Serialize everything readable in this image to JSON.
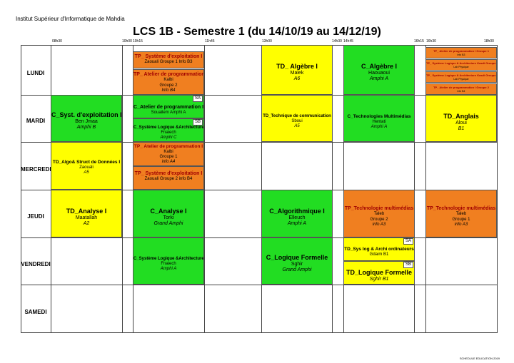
{
  "institute": "Institut Supérieur d'Informatique de Mahdia",
  "title": "LCS 1B - Semestre 1 (du 14/10/19 au 14/12/19)",
  "time_labels": [
    "08h30",
    "10h00",
    "10h15",
    "11h45",
    "13h00",
    "14h30",
    "14h45",
    "16h15",
    "16h30",
    "18h00"
  ],
  "days": [
    "LUNDI",
    "MARDI",
    "MERCREDI",
    "JEUDI",
    "VENDREDI",
    "SAMEDI"
  ],
  "sessions": {
    "lun_tp_sys": {
      "t": "TP_ Système d'exploitation I",
      "s": "Zaouali Groupe 1 Info B3"
    },
    "lun_tp_atelier": {
      "t": "TP_ Atelier de programmation I",
      "s": "Kalbi",
      "s2": "Groupe 2",
      "i": "Info B4"
    },
    "lun_td_alg": {
      "t": "TD_ Algèbre I",
      "s": "Malek",
      "i": "A6"
    },
    "lun_c_alg": {
      "t": "C_Algèbre I",
      "s": "Haouaoui",
      "i": "Amphi A"
    },
    "lun_s1": {
      "t": "TP_ Atelier de programmation I Groupe 1",
      "s": "info B3"
    },
    "lun_s2": {
      "t": "TP_ Système Logique & Architecture Kasdi Groupe 2",
      "s": "Lab Physique"
    },
    "lun_s3": {
      "t": "TP_ Système Logique & Architecture Kasdi Groupe 1",
      "s": "Lab Physique"
    },
    "lun_s4": {
      "t": "TP_ Atelier de programmation I Groupe 2",
      "s": "info B4"
    },
    "mar_c_sys": {
      "t": "C_Syst. d'exploitation I",
      "s": "Ben Jmaa",
      "i": "Amphi B"
    },
    "mar_c_atelier": {
      "t": "C_Atelier de programmation I",
      "s": "Souailem Amphi A",
      "tag": "SA"
    },
    "mar_c_syslog": {
      "t": "C_Système Logique &Architecture",
      "s": "Fnaiech",
      "i": "Amphi C",
      "tag": "SB"
    },
    "mar_td_tech": {
      "t": "TD_Technique de communication",
      "s": "Sboui",
      "i": "A5"
    },
    "mar_c_techmm": {
      "t": "C_Technologies Multimédias",
      "s": "Hentati",
      "i": "Amphi A"
    },
    "mar_td_ang": {
      "t": "TD_Anglais",
      "s": "Aloui",
      "i": "B1"
    },
    "mer_td_algo": {
      "t": "TD_Algo& Struct de Données I",
      "s": "Zaouali",
      "i": "A5"
    },
    "mer_tp_atelier": {
      "t": "TP_ Atelier de programmation I",
      "s": "Kalbi",
      "s2": "Groupe 1",
      "i": "info A4"
    },
    "mer_tp_sys": {
      "t": "TP_ Système d'exploitation I",
      "s": "Zaouali Groupe 2 info B4"
    },
    "jeu_td_ana": {
      "t": "TD_Analyse I",
      "s": "Maatallah",
      "i": "A2"
    },
    "jeu_c_ana": {
      "t": "C_Analyse I",
      "s": "Torki",
      "i": "Grand Amphi"
    },
    "jeu_c_algo": {
      "t": "C_Algorithmique I",
      "s": "Elleuch",
      "i": "Amphi A"
    },
    "jeu_tp_tech2": {
      "t": "TP_Technologie multimédias",
      "s": "Taleb",
      "s2": "Groupe 2",
      "i": "info A3"
    },
    "jeu_tp_tech1": {
      "t": "TP_Technologie multimédias",
      "s": "Taleb",
      "s2": "Groupe 1",
      "i": "info A3"
    },
    "ven_c_syslog": {
      "t": "C_Système Logique &Architecture",
      "s": "Fnaiech",
      "i": "Amphi A"
    },
    "ven_c_log": {
      "t": "C_Logique Formelle",
      "s": "Sghir",
      "i": "Grand Amphi"
    },
    "ven_td_sys": {
      "t": "TD_Sys log & Archi ordinateurs",
      "s": "Gdaim B1",
      "tag": "SA"
    },
    "ven_td_log": {
      "t": "TD_Logique Formelle",
      "i": "Sghir B1",
      "tag": "SB"
    }
  },
  "footer": "SCHEDULE EDUCATION 2019",
  "colors": {
    "yellow": "#ffff00",
    "orange": "#f07f20",
    "green": "#22dd22"
  }
}
